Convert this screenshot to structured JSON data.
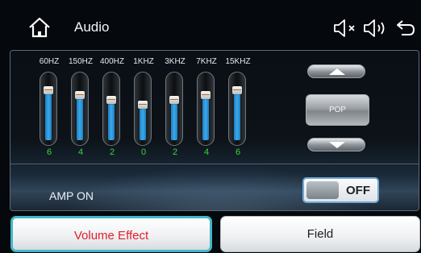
{
  "header": {
    "title": "Audio",
    "icons": {
      "home": "home-icon",
      "mute": "mute-icon",
      "speaker": "speaker-icon",
      "back": "back-icon"
    }
  },
  "equalizer": {
    "bands": [
      {
        "label": "60HZ",
        "value": "6",
        "level": 0.8
      },
      {
        "label": "150HZ",
        "value": "4",
        "level": 0.73
      },
      {
        "label": "400HZ",
        "value": "2",
        "level": 0.65
      },
      {
        "label": "1KHZ",
        "value": "0",
        "level": 0.57
      },
      {
        "label": "3KHZ",
        "value": "2",
        "level": 0.65
      },
      {
        "label": "7KHZ",
        "value": "4",
        "level": 0.73
      },
      {
        "label": "15KHZ",
        "value": "6",
        "level": 0.8
      }
    ],
    "preset": {
      "label": "POP",
      "up_icon": "chevron-up-icon",
      "down_icon": "chevron-down-icon"
    }
  },
  "amp": {
    "label": "AMP ON",
    "state": "OFF"
  },
  "tabs": [
    {
      "label": "Volume Effect",
      "active": true
    },
    {
      "label": "Field",
      "active": false
    }
  ],
  "colors": {
    "accent": "#43b7c8",
    "active_text": "#e11f2c",
    "value_text": "#3bd33f",
    "fill": "#3aa9ea"
  }
}
